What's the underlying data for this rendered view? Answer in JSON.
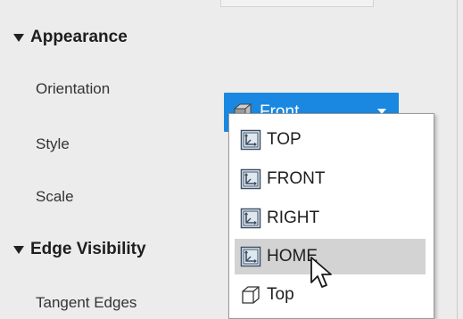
{
  "sections": {
    "appearance": {
      "title": "Appearance"
    },
    "edge_visibility": {
      "title": "Edge Visibility"
    }
  },
  "properties": {
    "orientation": {
      "label": "Orientation"
    },
    "style": {
      "label": "Style"
    },
    "scale": {
      "label": "Scale"
    },
    "tangent_edges": {
      "label": "Tangent Edges"
    }
  },
  "orientation_select": {
    "selected_value": "Front",
    "icon": "cube-view-icon",
    "accent_color": "#1a88e0"
  },
  "orientation_dropdown": {
    "items": [
      {
        "label": "TOP",
        "icon": "named-view-icon"
      },
      {
        "label": "FRONT",
        "icon": "named-view-icon"
      },
      {
        "label": "RIGHT",
        "icon": "named-view-icon"
      },
      {
        "label": "HOME",
        "icon": "named-view-icon",
        "hovered": true
      },
      {
        "label": "Top",
        "icon": "cube-view-icon"
      }
    ],
    "hover_color": "#d3d3d3"
  }
}
